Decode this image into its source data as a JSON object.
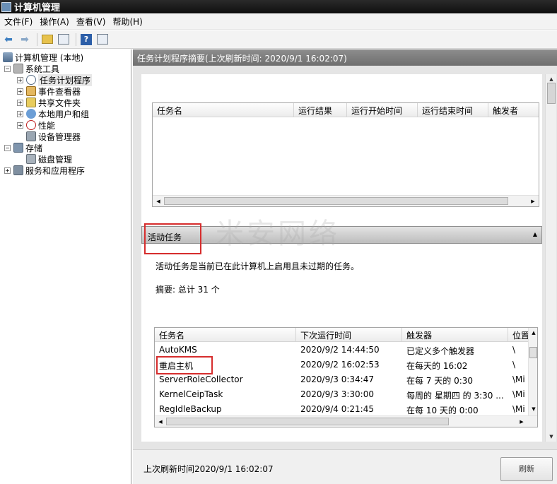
{
  "window": {
    "title": "计算机管理"
  },
  "menu": [
    "文件(F)",
    "操作(A)",
    "查看(V)",
    "帮助(H)"
  ],
  "toolbar": {
    "icons": [
      "back-icon",
      "forward-icon",
      "up-folder-icon",
      "show-hide-tree-icon",
      "help-icon",
      "properties-icon"
    ]
  },
  "tree": {
    "root": "计算机管理 (本地)",
    "system_tools": "系统工具",
    "task_scheduler": "任务计划程序",
    "event_viewer": "事件查看器",
    "shared_folders": "共享文件夹",
    "local_users": "本地用户和组",
    "performance": "性能",
    "device_manager": "设备管理器",
    "storage": "存储",
    "disk_management": "磁盘管理",
    "services_apps": "服务和应用程序"
  },
  "main": {
    "header": "任务计划程序摘要(上次刷新时间: 2020/9/1 16:02:07)",
    "upper_table": {
      "columns": [
        "任务名",
        "运行结果",
        "运行开始时间",
        "运行结束时间",
        "触发者"
      ]
    },
    "section_title": "活动任务",
    "description": "活动任务是当前已在此计算机上启用且未过期的任务。",
    "summary": "摘要: 总计 31 个",
    "watermark": "米安网络",
    "active_table": {
      "columns": [
        "任务名",
        "下次运行时间",
        "触发器",
        "位置"
      ],
      "rows": [
        [
          "AutoKMS",
          "2020/9/2 14:44:50",
          "已定义多个触发器",
          "\\"
        ],
        [
          "重启主机",
          "2020/9/2 16:02:53",
          "在每天的 16:02",
          "\\"
        ],
        [
          "ServerRoleCollector",
          "2020/9/3 0:34:47",
          "在每 7 天的 0:30",
          "\\Mi"
        ],
        [
          "KernelCeipTask",
          "2020/9/3 3:30:00",
          "每周的 星期四 的 3:30 ...",
          "\\Mi"
        ],
        [
          "RegIdleBackup",
          "2020/9/4 0:21:45",
          "在每 10 天的 0:00",
          "\\Mi"
        ]
      ]
    }
  },
  "footer": {
    "last_refresh": "上次刷新时间2020/9/1 16:02:07",
    "refresh_button": "刷新"
  }
}
